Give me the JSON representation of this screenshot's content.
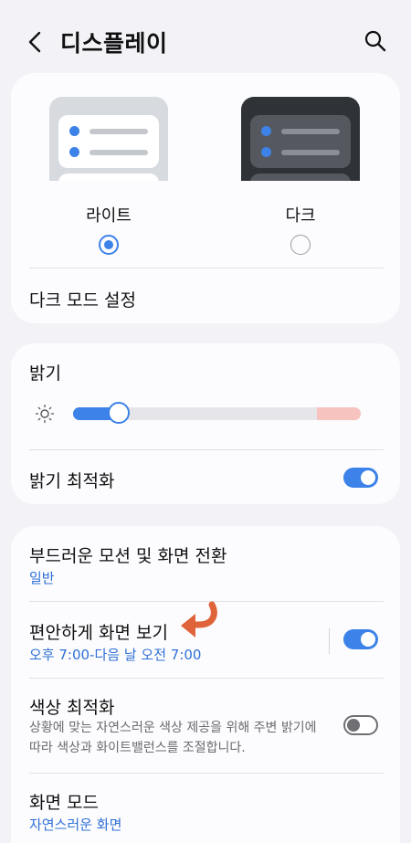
{
  "header": {
    "title": "디스플레이"
  },
  "theme": {
    "light_label": "라이트",
    "dark_label": "다크",
    "selected": "light",
    "dark_mode_settings": "다크 모드 설정"
  },
  "brightness": {
    "title": "밝기",
    "level_percent": 16,
    "adaptive_label": "밝기 최적화",
    "adaptive_on": true
  },
  "motion": {
    "title": "부드러운 모션 및 화면 전환",
    "value": "일반"
  },
  "eye_comfort": {
    "title": "편안하게 화면 보기",
    "schedule": "오후 7:00-다음 날 오전 7:00",
    "on": true
  },
  "color_opt": {
    "title": "색상 최적화",
    "description": "상황에 맞는 자연스러운 색상 제공을 위해 주변 밝기에 따라 색상과 화이트밸런스를 조절합니다.",
    "on": false
  },
  "screen_mode": {
    "title": "화면 모드",
    "value": "자연스러운 화면"
  },
  "colors": {
    "accent": "#3c82e8",
    "annotation_arrow": "#e0643a"
  }
}
